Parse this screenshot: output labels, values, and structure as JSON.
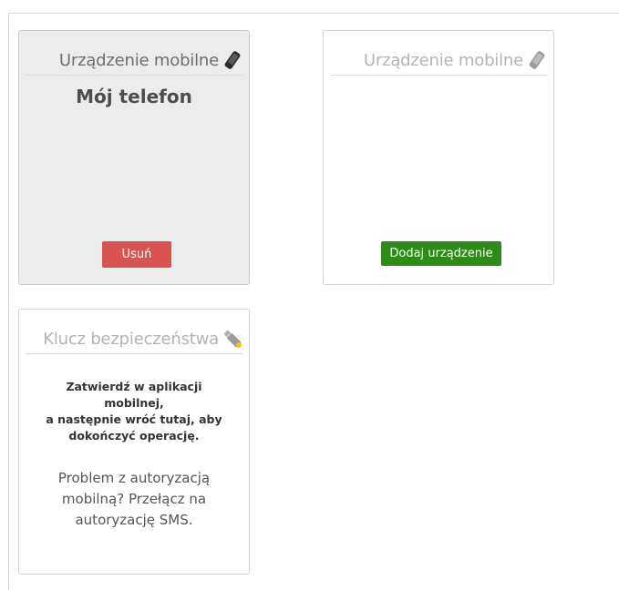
{
  "cards": [
    {
      "header": "Urządzenie mobilne",
      "icon": "mobile-phone-icon",
      "state": "selected",
      "device_name": "Mój telefon",
      "button_label": "Usuń"
    },
    {
      "header": "Urządzenie mobilne",
      "icon": "mobile-phone-icon",
      "state": "empty",
      "button_label": "Dodaj urządzenie"
    },
    {
      "header": "Klucz bezpieczeństwa",
      "icon": "usb-key-icon",
      "state": "disabled",
      "confirm_lines": [
        "Zatwierdź w aplikacji",
        "mobilnej,",
        "a następnie wróć tutaj, aby",
        "dokończyć operację."
      ],
      "problem_lines": [
        "Problem z autoryzacją",
        "mobilną? Przełącz na",
        "autoryzację SMS."
      ]
    }
  ],
  "colors": {
    "remove_button": "#d9534f",
    "add_button": "#2e8b18",
    "selected_card_bg": "#ececec"
  }
}
